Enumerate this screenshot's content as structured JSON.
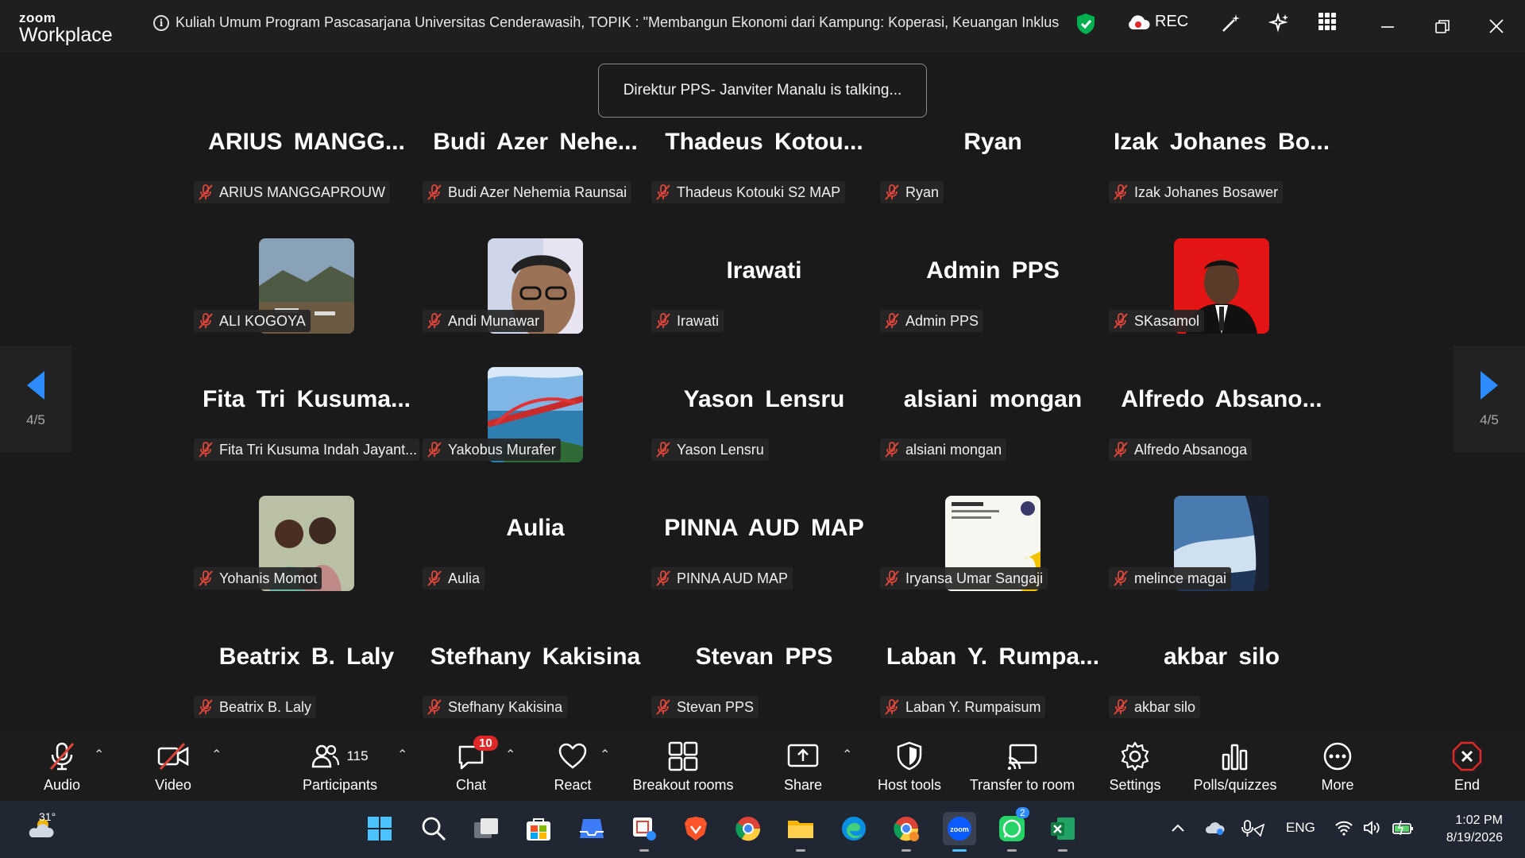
{
  "app": {
    "brand_top": "zoom",
    "brand_bottom": "Workplace"
  },
  "meeting": {
    "title": "Kuliah Umum Program Pascasarjana Universitas Cenderawasih, TOPIK : \"Membangun Ekonomi dari Kampung: Koperasi, Keuangan Inklus"
  },
  "recording": {
    "label": "REC"
  },
  "talking": "Direktur PPS- Janviter Manalu is talking...",
  "page_indicator": "4/5",
  "participants": [
    {
      "big": "ARIUS  MANGG...",
      "name": "ARIUS MANGGAPROUW",
      "pic": ""
    },
    {
      "big": "Budi  Azer  Nehe...",
      "name": "Budi Azer Nehemia Raunsai",
      "pic": ""
    },
    {
      "big": "Thadeus  Kotou...",
      "name": "Thadeus Kotouki S2 MAP",
      "pic": ""
    },
    {
      "big": "Ryan",
      "name": "Ryan",
      "pic": ""
    },
    {
      "big": "Izak  Johanes  Bo...",
      "name": "Izak Johanes Bosawer",
      "pic": ""
    },
    {
      "big": "",
      "name": "ALI KOGOYA",
      "pic": "landscape"
    },
    {
      "big": "",
      "name": "Andi Munawar",
      "pic": "face"
    },
    {
      "big": "Irawati",
      "name": "Irawati",
      "pic": ""
    },
    {
      "big": "Admin PPS",
      "name": "Admin PPS",
      "pic": ""
    },
    {
      "big": "",
      "name": "SKasamol",
      "pic": "redportrait"
    },
    {
      "big": "Fita  Tri  Kusuma...",
      "name": "Fita Tri Kusuma Indah Jayant...",
      "pic": ""
    },
    {
      "big": "",
      "name": "Yakobus Murafer",
      "pic": "bridge"
    },
    {
      "big": "Yason Lensru",
      "name": "Yason Lensru",
      "pic": ""
    },
    {
      "big": "alsiani mongan",
      "name": "alsiani mongan",
      "pic": ""
    },
    {
      "big": "Alfredo  Absano...",
      "name": "Alfredo Absanoga",
      "pic": ""
    },
    {
      "big": "",
      "name": "Yohanis Momot",
      "pic": "kids"
    },
    {
      "big": "Aulia",
      "name": "Aulia",
      "pic": ""
    },
    {
      "big": "PINNA AUD MAP",
      "name": "PINNA AUD MAP",
      "pic": ""
    },
    {
      "big": "",
      "name": "Iryansa Umar Sangaji",
      "pic": "document"
    },
    {
      "big": "",
      "name": "melince magai",
      "pic": "sky"
    },
    {
      "big": "Beatrix B. Laly",
      "name": "Beatrix B. Laly",
      "pic": ""
    },
    {
      "big": "Stefhany Kakisina",
      "name": "Stefhany Kakisina",
      "pic": ""
    },
    {
      "big": "Stevan PPS",
      "name": "Stevan PPS",
      "pic": ""
    },
    {
      "big": "Laban  Y.  Rumpa...",
      "name": "Laban Y. Rumpaisum",
      "pic": ""
    },
    {
      "big": "akbar silo",
      "name": "akbar silo",
      "pic": ""
    }
  ],
  "toolbar": {
    "audio": "Audio",
    "video": "Video",
    "participants": "Participants",
    "participants_count": "115",
    "chat": "Chat",
    "chat_badge": "10",
    "react": "React",
    "breakout": "Breakout rooms",
    "share": "Share",
    "host_tools": "Host tools",
    "transfer": "Transfer to room",
    "settings": "Settings",
    "polls": "Polls/quizzes",
    "more": "More",
    "end": "End"
  },
  "taskbar": {
    "weather_temp": "31°",
    "whatsapp_badge": "2",
    "language": "ENG",
    "time": "1:02 PM",
    "date": "8/19/2026"
  },
  "colors": {
    "accent": "#0b5cff",
    "shield_green": "#00b050",
    "mic_off_red": "#e0453a",
    "end_red": "#e02828"
  }
}
